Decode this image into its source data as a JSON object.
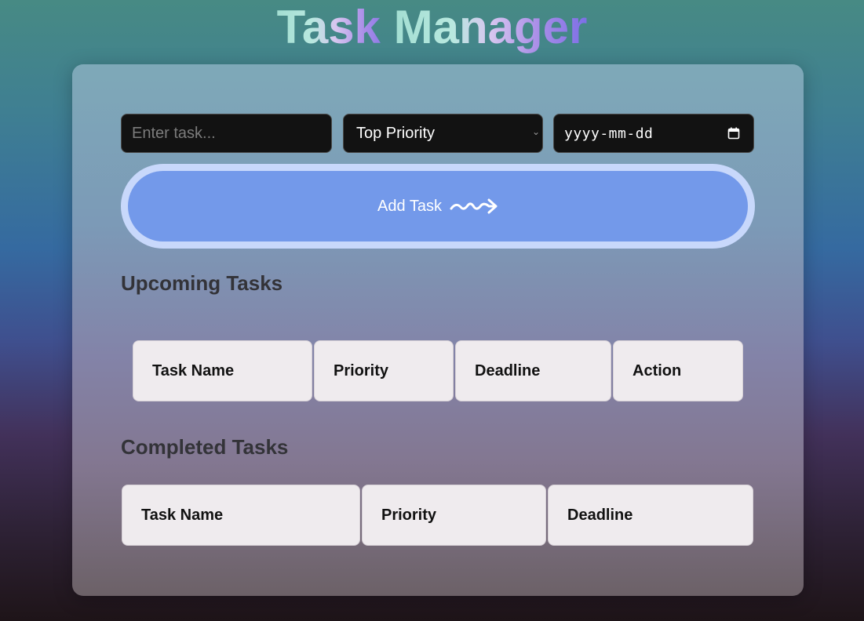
{
  "title": {
    "part1": "Task ",
    "part2": "Manager"
  },
  "form": {
    "task_placeholder": "Enter task...",
    "priority_selected": "Top Priority",
    "date_placeholder": "yyyy-mm-dd",
    "add_button_label": "Add Task"
  },
  "upcoming": {
    "heading": "Upcoming Tasks",
    "columns": [
      "Task Name",
      "Priority",
      "Deadline",
      "Action"
    ]
  },
  "completed": {
    "heading": "Completed Tasks",
    "columns": [
      "Task Name",
      "Priority",
      "Deadline"
    ]
  },
  "colors": {
    "button_fill": "#7399ea",
    "button_ring": "#c8d8fb",
    "input_bg": "#121212",
    "header_cell_bg": "#efebee"
  },
  "icons": {
    "date": "calendar-icon",
    "button": "squiggle-arrow-icon",
    "select": "chevron-down-icon"
  }
}
